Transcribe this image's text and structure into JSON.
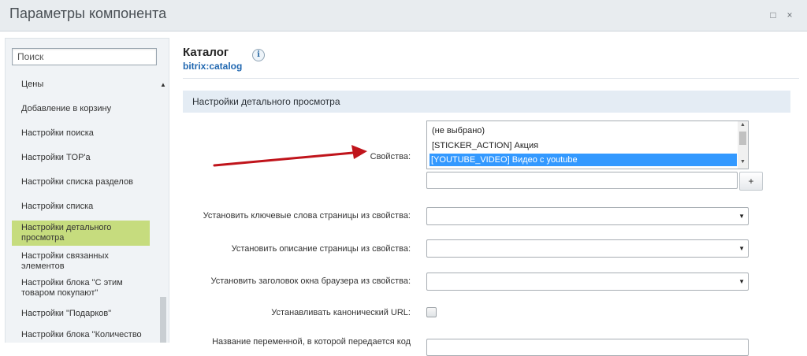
{
  "window": {
    "title": "Параметры компонента",
    "controls": {
      "maximize_icon": "maximize-icon",
      "close_icon": "close-icon",
      "maximize_glyph": "□",
      "close_glyph": "×"
    }
  },
  "sidebar": {
    "search_placeholder": "Поиск",
    "items": [
      {
        "label": "Цены"
      },
      {
        "label": "Добавление в корзину"
      },
      {
        "label": "Настройки поиска"
      },
      {
        "label": "Настройки TOP'а"
      },
      {
        "label": "Настройки списка разделов"
      },
      {
        "label": "Настройки списка"
      },
      {
        "label": "Настройки детального просмотра",
        "active": true
      },
      {
        "label": "Настройки связанных элементов"
      },
      {
        "label": "Настройки блока \"С этим товаром покупают\""
      },
      {
        "label": "Настройки \"Подарков\""
      },
      {
        "label": "Настройки блока \"Количество"
      }
    ]
  },
  "component": {
    "title": "Каталог",
    "code": "bitrix:catalog",
    "info_glyph": "i"
  },
  "section": {
    "title": "Настройки детального просмотра"
  },
  "form": {
    "properties_label": "Свойства:",
    "properties_options": [
      {
        "label": "(не выбрано)",
        "selected": false
      },
      {
        "label": "[STICKER_ACTION] Акция",
        "selected": false
      },
      {
        "label": "[YOUTUBE_VIDEO] Видео с youtube",
        "selected": true
      }
    ],
    "add_button": "+",
    "keywords_label": "Установить ключевые слова страницы из свойства:",
    "description_label": "Установить описание страницы из свойства:",
    "browser_title_label": "Установить заголовок окна браузера из свойства:",
    "canonical_label": "Устанавливать канонический URL:",
    "variable_name_label": "Название переменной, в которой передается код"
  },
  "colors": {
    "accent_link": "#2067b0",
    "active_item": "#c6dc7e",
    "selected_option": "#3399ff",
    "annotation_arrow": "#c0141b"
  }
}
